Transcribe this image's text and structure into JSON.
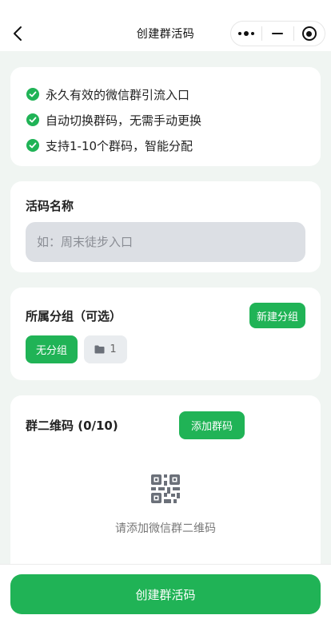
{
  "header": {
    "title": "创建群活码",
    "back_icon": "chevron-left-icon",
    "capsule_icons": [
      "more-icon",
      "minimize-icon",
      "target-icon"
    ]
  },
  "features": {
    "items": [
      "永久有效的微信群引流入口",
      "自动切换群码，无需手动更换",
      "支持1-10个群码，智能分配"
    ]
  },
  "name_section": {
    "label": "活码名称",
    "placeholder": "如：周末徒步入口",
    "value": ""
  },
  "group_section": {
    "label": "所属分组（可选）",
    "new_group_label": "新建分组",
    "chips": [
      {
        "label": "无分组",
        "selected": true
      },
      {
        "label": "1",
        "icon": "folder-icon",
        "selected": false
      }
    ]
  },
  "qr_section": {
    "label": "群二维码 (0/10)",
    "add_label": "添加群码",
    "empty_hint": "请添加微信群二维码",
    "empty_icon": "qr-code-icon"
  },
  "footer": {
    "create_label": "创建群活码"
  },
  "colors": {
    "accent": "#20b356",
    "background": "#f0f5f2",
    "input_bg": "#dcdfe4"
  }
}
